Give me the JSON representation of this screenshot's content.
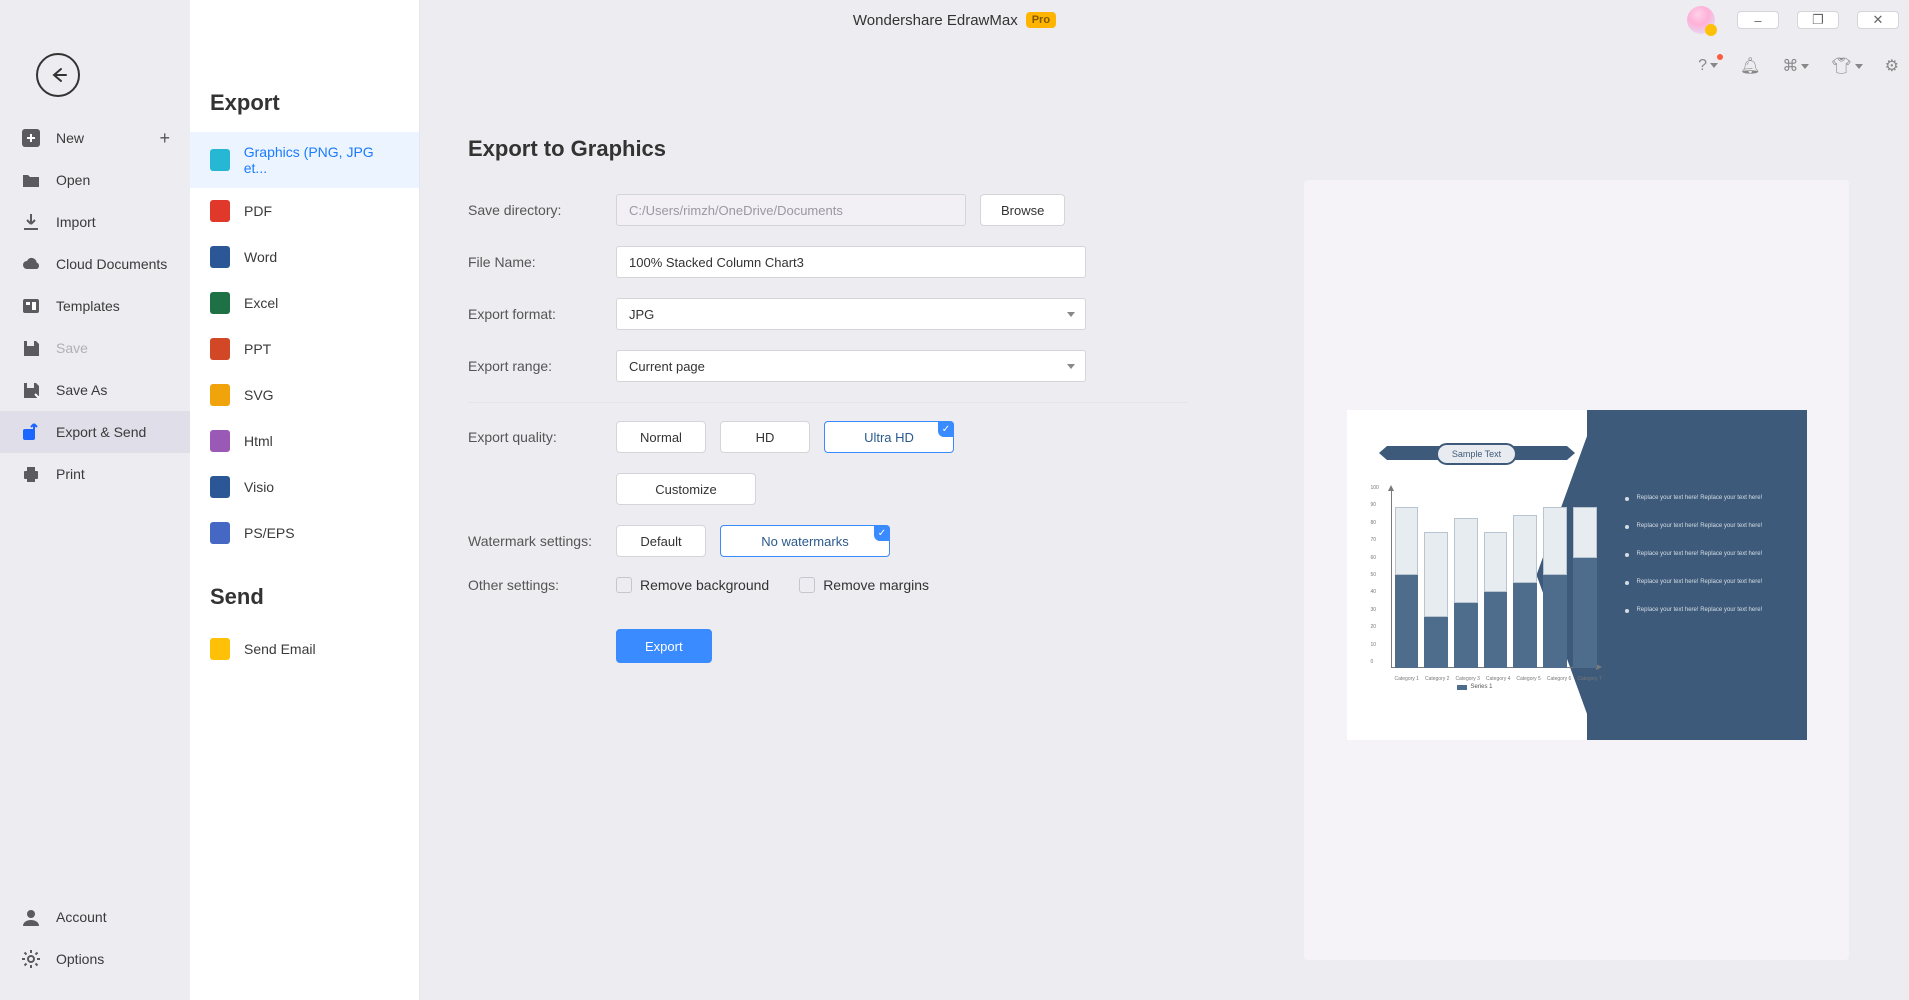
{
  "app": {
    "title": "Wondershare EdrawMax",
    "badge": "Pro"
  },
  "win": {
    "min": "–",
    "max": "❐",
    "close": "✕"
  },
  "rail": {
    "items": [
      {
        "id": "new",
        "label": "New",
        "icon": "plus-square",
        "plus": true
      },
      {
        "id": "open",
        "label": "Open",
        "icon": "folder"
      },
      {
        "id": "import",
        "label": "Import",
        "icon": "download"
      },
      {
        "id": "cloud",
        "label": "Cloud Documents",
        "icon": "cloud"
      },
      {
        "id": "tmpl",
        "label": "Templates",
        "icon": "templates"
      },
      {
        "id": "save",
        "label": "Save",
        "icon": "save",
        "disabled": true
      },
      {
        "id": "saveas",
        "label": "Save As",
        "icon": "saveas"
      },
      {
        "id": "exportsend",
        "label": "Export & Send",
        "icon": "export",
        "active": true,
        "special": true
      },
      {
        "id": "print",
        "label": "Print",
        "icon": "print"
      }
    ],
    "bottom": [
      {
        "id": "account",
        "label": "Account",
        "icon": "user"
      },
      {
        "id": "options",
        "label": "Options",
        "icon": "gear"
      }
    ]
  },
  "mid": {
    "heading_export": "Export",
    "heading_send": "Send",
    "export_items": [
      {
        "id": "graphics",
        "label": "Graphics (PNG, JPG et...",
        "color": "#25b7d3",
        "active": true
      },
      {
        "id": "pdf",
        "label": "PDF",
        "color": "#e0392b"
      },
      {
        "id": "word",
        "label": "Word",
        "color": "#2b5797"
      },
      {
        "id": "excel",
        "label": "Excel",
        "color": "#1e7145"
      },
      {
        "id": "ppt",
        "label": "PPT",
        "color": "#d24726"
      },
      {
        "id": "svg",
        "label": "SVG",
        "color": "#f0a30a"
      },
      {
        "id": "html",
        "label": "Html",
        "color": "#9b59b6"
      },
      {
        "id": "visio",
        "label": "Visio",
        "color": "#2b5797"
      },
      {
        "id": "pseps",
        "label": "PS/EPS",
        "color": "#4668c5"
      }
    ],
    "send_items": [
      {
        "id": "email",
        "label": "Send Email",
        "color": "#ffc107"
      }
    ]
  },
  "form": {
    "title": "Export to Graphics",
    "labels": {
      "dir": "Save directory:",
      "name": "File Name:",
      "format": "Export format:",
      "range": "Export range:",
      "quality": "Export quality:",
      "watermark": "Watermark settings:",
      "other": "Other settings:"
    },
    "dir": "C:/Users/rimzh/OneDrive/Documents",
    "browse": "Browse",
    "name": "100% Stacked Column Chart3",
    "format": "JPG",
    "range": "Current page",
    "quality": {
      "normal": "Normal",
      "hd": "HD",
      "uhd": "Ultra HD",
      "customize": "Customize"
    },
    "watermark": {
      "default": "Default",
      "none": "No watermarks"
    },
    "other": {
      "removebg": "Remove background",
      "removemargin": "Remove margins"
    },
    "export": "Export"
  },
  "preview": {
    "ribbon": "Sample Text",
    "bullet": "Replace your text here! Replace your text here!",
    "legend": "Series 1",
    "y_ticks": [
      "100",
      "90",
      "80",
      "70",
      "60",
      "50",
      "40",
      "30",
      "20",
      "10",
      "0"
    ],
    "categories": [
      "Category 1",
      "Category 2",
      "Category 3",
      "Category 4",
      "Category 5",
      "Category 6",
      "Category 7"
    ]
  },
  "chart_data": {
    "type": "bar",
    "title": "Sample Text",
    "ylabel": "",
    "xlabel": "",
    "ylim": [
      0,
      100
    ],
    "categories": [
      "Category 1",
      "Category 2",
      "Category 3",
      "Category 4",
      "Category 5",
      "Category 6",
      "Category 7"
    ],
    "series": [
      {
        "name": "Series 1 (lower)",
        "values": [
          55,
          30,
          38,
          45,
          50,
          55,
          65
        ]
      },
      {
        "name": "Series 1 (upper)",
        "values": [
          40,
          50,
          50,
          35,
          40,
          40,
          30
        ]
      }
    ],
    "legend": [
      "Series 1"
    ]
  }
}
